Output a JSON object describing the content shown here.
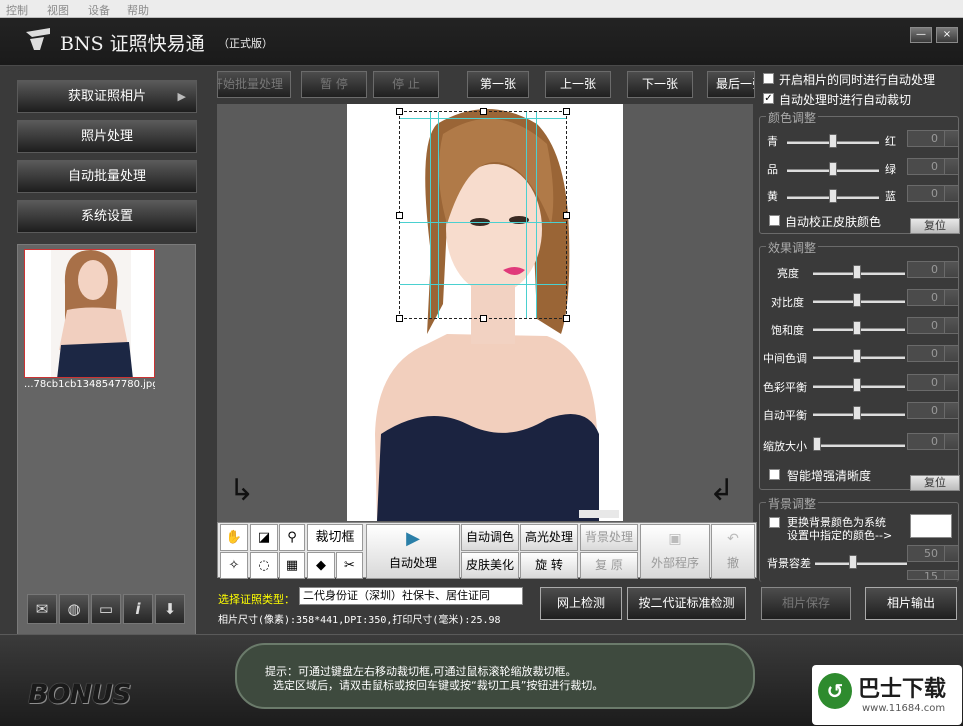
{
  "menu": [
    "控制",
    "视图",
    "设备",
    "帮助"
  ],
  "app": {
    "name": "BNS 证照快易通",
    "edition": "（正式版）",
    "brand": "BONUS",
    "min_label": "—",
    "close_label": "×"
  },
  "left_nav": [
    "获取证照相片",
    "照片处理",
    "自动批量处理",
    "系统设置"
  ],
  "thumbnail": {
    "filename": "...78cb1cb1348547780.jpg"
  },
  "toolbar": [
    "开始批量处理",
    "暂 停",
    "停 止",
    "第一张",
    "上一张",
    "下一张",
    "最后一张"
  ],
  "tools": {
    "crop_label": "裁切框",
    "auto_process": "自动处理",
    "auto_color": "自动调色",
    "highlight": "高光处理",
    "bg_process": "背景处理",
    "skin": "皮肤美化",
    "rotate": "旋 转",
    "restore": "复 原",
    "external": "外部程序",
    "undo": "撤"
  },
  "id_type": {
    "label": "选择证照类型：",
    "value": "二代身份证（深圳）社保卡、居住证同"
  },
  "photo_info": "相片尺寸(像素):358*441,DPI:350,打印尺寸(毫米):25.98",
  "check_buttons": [
    "网上检测",
    "按二代证标准检测"
  ],
  "options": [
    "开启相片的同时进行自动处理",
    "自动处理时进行自动裁切"
  ],
  "options_checked": [
    false,
    true
  ],
  "color_adjust": {
    "title": "颜色调整",
    "rows": [
      {
        "left": "青",
        "right": "红",
        "value": "0"
      },
      {
        "left": "品",
        "right": "绿",
        "value": "0"
      },
      {
        "left": "黄",
        "right": "蓝",
        "value": "0"
      }
    ],
    "auto_skin": "自动校正皮肤颜色",
    "reset": "复位"
  },
  "effect_adjust": {
    "title": "效果调整",
    "rows": [
      {
        "label": "亮度",
        "value": "0"
      },
      {
        "label": "对比度",
        "value": "0"
      },
      {
        "label": "饱和度",
        "value": "0"
      },
      {
        "label": "中间色调",
        "value": "0"
      },
      {
        "label": "色彩平衡",
        "value": "0"
      },
      {
        "label": "自动平衡",
        "value": "0"
      },
      {
        "label": "缩放大小",
        "value": "0"
      }
    ],
    "sharpen": "智能增强清晰度",
    "reset": "复位"
  },
  "bg_adjust": {
    "title": "背景调整",
    "change_line1": "更换背景颜色为系统",
    "change_line2": "设置中指定的颜色-->",
    "tolerance_label": "背景容差",
    "tolerance_value": "50",
    "second_value": "15"
  },
  "output_buttons": [
    "相片保存",
    "相片输出"
  ],
  "hint": {
    "line1": "提示：可通过键盘左右移动裁切框,可通过鼠标滚轮缩放裁切框。",
    "line2": "选定区域后，请双击鼠标或按回车键或按“裁切工具”按钮进行裁切。"
  },
  "watermark": {
    "name": "巴士下载",
    "url": "www.11684.com"
  },
  "colors": {
    "accent": "#ffff00",
    "thumb_border": "#cc3333",
    "watermark_green": "#2e8b2e"
  }
}
